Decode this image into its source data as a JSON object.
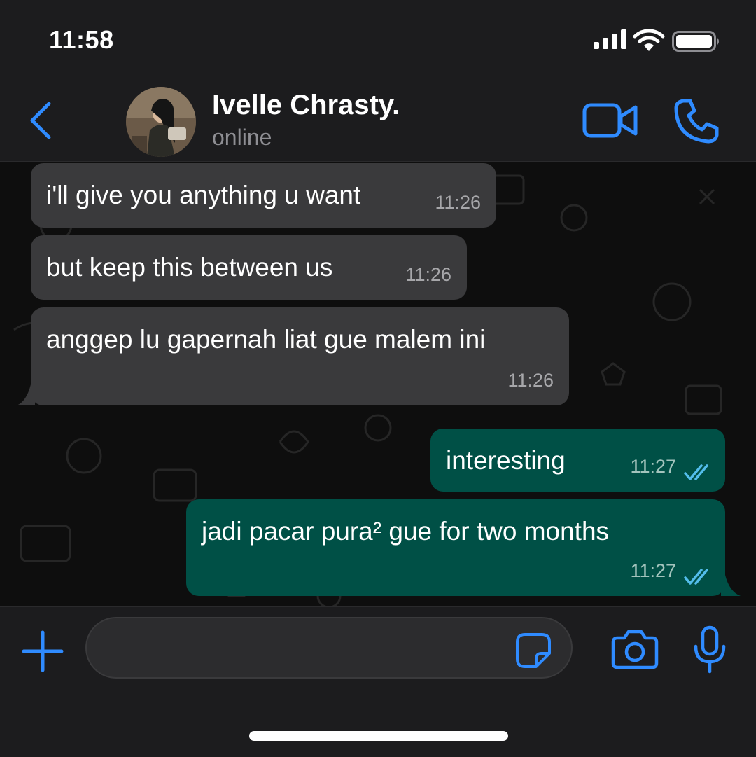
{
  "status_bar": {
    "time": "11:58",
    "battery_level": 0.8
  },
  "header": {
    "contact_name": "Ivelle Chrasty.",
    "contact_status": "online"
  },
  "messages": [
    {
      "direction": "incoming",
      "text": "i'll give you anything u want",
      "time": "11:26"
    },
    {
      "direction": "incoming",
      "text": "but keep this between us",
      "time": "11:26"
    },
    {
      "direction": "incoming",
      "text": "anggep lu gapernah liat gue malem ini",
      "time": "11:26"
    },
    {
      "direction": "outgoing",
      "text": "interesting",
      "time": "11:27",
      "status": "read"
    },
    {
      "direction": "outgoing",
      "text": "jadi pacar pura² gue for two months",
      "time": "11:27",
      "status": "read"
    }
  ],
  "composer": {
    "message_value": ""
  },
  "colors": {
    "accent": "#2f8bff",
    "incoming_bubble": "#3a3a3c",
    "outgoing_bubble": "#005046",
    "read_ticks": "#53bdeb"
  },
  "icons": [
    "back-chevron-icon",
    "video-call-icon",
    "phone-call-icon",
    "plus-icon",
    "sticker-icon",
    "camera-icon",
    "microphone-icon",
    "double-check-icon"
  ]
}
